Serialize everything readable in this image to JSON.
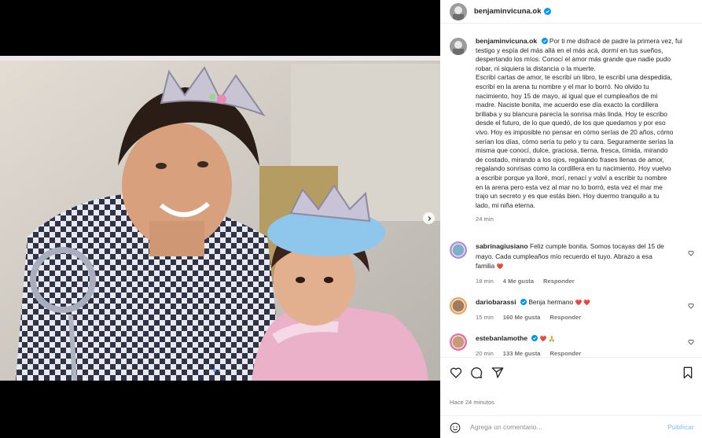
{
  "post": {
    "username": "benjaminvicuna.ok",
    "caption_lines": [
      "Por ti me disfracé de padre la primera vez, fui",
      "testigo y espía del más allá en el más acá, dormí en tus sueños,",
      "despertando los míos. Conocí el amor más grande que nadie pudo",
      "robar, ni siquiera la distancia o la muerte.",
      "Escribí cartas de amor, te escribí un libro, te escribí una despedida,",
      "escribí en la arena tu nombre y el mar lo borró. No olvido tu",
      "nacimiento, hoy 15 de mayo, al igual que el cumpleaños de mi",
      "madre. Naciste bonita, me acuerdo ese día exacto la cordillera",
      "brillaba y su blancura parecía la sonrisa más linda. Hoy te escribo",
      "desde el futuro, de lo que quedó, de los que quedamos y por eso",
      "vivo. Hoy es imposible no pensar en cómo serías de 20 años, cómo",
      "serían los días, cómo sería tu pelo y tu cara. Seguramente serías la",
      "misma que conocí, dulce, graciosa, tierna, fresca, tímida, mirando",
      "de costado, mirando a los ojos, regalando frases llenas de amor,",
      "regalando sonrisas como la cordillera en tu nacimiento. Hoy vuelvo",
      "a escribir porque ya lloré, morí, renací y volví a escribir tu nombre",
      "en la arena pero esta vez al mar no lo borró, esta vez el mar me",
      "trajo un secreto y es que estás bien. Hoy duermo tranquilo a tu",
      "lado, mi niña eterna."
    ],
    "caption_time": "24 min",
    "time_ago": "Hace 24 minutos"
  },
  "comments": [
    {
      "username": "sabrinagiusiano",
      "verified": false,
      "lines": [
        "Feliz cumple bonita. Somos tocayas del 15 de",
        "mayo. Cada cumpleaños mío recuerdo el tuyo. Abrazo a esa",
        "familia"
      ],
      "emoji": "❤️",
      "time": "18 min",
      "likes": "4 Me gusta",
      "reply": "Responder"
    },
    {
      "username": "dariobarassi",
      "verified": true,
      "lines": [
        "Benja hermano"
      ],
      "emoji": "❤️ ❤️",
      "time": "15 min",
      "likes": "160 Me gusta",
      "reply": "Responder"
    },
    {
      "username": "estebanlamothe",
      "verified": true,
      "lines": [
        ""
      ],
      "emoji": "❤️ 🙏",
      "time": "20 min",
      "likes": "133 Me gusta",
      "reply": "Responder"
    }
  ],
  "add_comment": {
    "placeholder": "Agrega un comentario...",
    "post_label": "Publicar"
  },
  "icons": {
    "like": "heart-icon",
    "comment": "comment-icon",
    "share": "share-icon",
    "save": "bookmark-icon",
    "emoji": "emoji-icon",
    "next": "chevron-right-icon",
    "verified": "verified-badge-icon"
  },
  "colors": {
    "verified": "#0095f6",
    "post_button": "#9fcdfa",
    "heart": "#ed4956"
  },
  "carousel": {
    "slides": 2,
    "active": 1
  }
}
